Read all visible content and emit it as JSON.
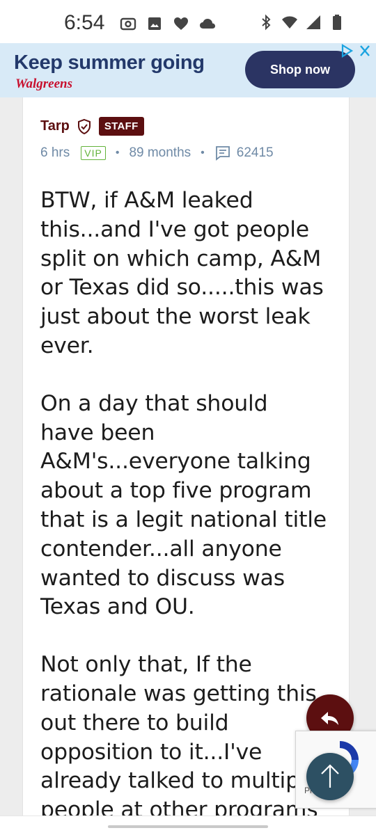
{
  "status_bar": {
    "time": "6:54",
    "left_icons": [
      "radio-icon",
      "image-icon",
      "heart-icon",
      "cloud-icon"
    ],
    "right_icons": [
      "bluetooth-icon",
      "wifi-icon",
      "signal-icon",
      "battery-icon"
    ]
  },
  "ad": {
    "headline": "Keep summer going",
    "brand": "Walgreens",
    "cta_label": "Shop now",
    "choices_icon": "adchoices-icon",
    "close_icon": "close-icon"
  },
  "post": {
    "author": "Tarp",
    "role_badge": "STAFF",
    "time_ago": "6 hrs",
    "membership_badge": "VIP",
    "tenure": "89 months",
    "comment_count": "62415",
    "paragraphs": [
      "BTW, if A&M leaked\nthis...and I've got people\nsplit on which camp, A&M\nor Texas did so.....this was\njust about the worst leak\never.",
      "On a day that should\nhave been\nA&M's...everyone talking\nabout a top five program\nthat is a legit national title\ncontender...all anyone\nwanted to discuss was\nTexas and OU.",
      "Not only that, If the\nrationale was getting this\nout there to build\nopposition to it...I've\nalready talked to multip\npeople at other programs"
    ]
  },
  "recaptcha": {
    "text": "Pr    erms"
  },
  "colors": {
    "brand_maroon": "#5c0f10",
    "vip_green": "#63b33a",
    "meta_blue": "#6f8aa6",
    "ad_background": "#d8eaf7",
    "ad_button": "#2b3463",
    "scroll_top_button": "#2d5063"
  }
}
